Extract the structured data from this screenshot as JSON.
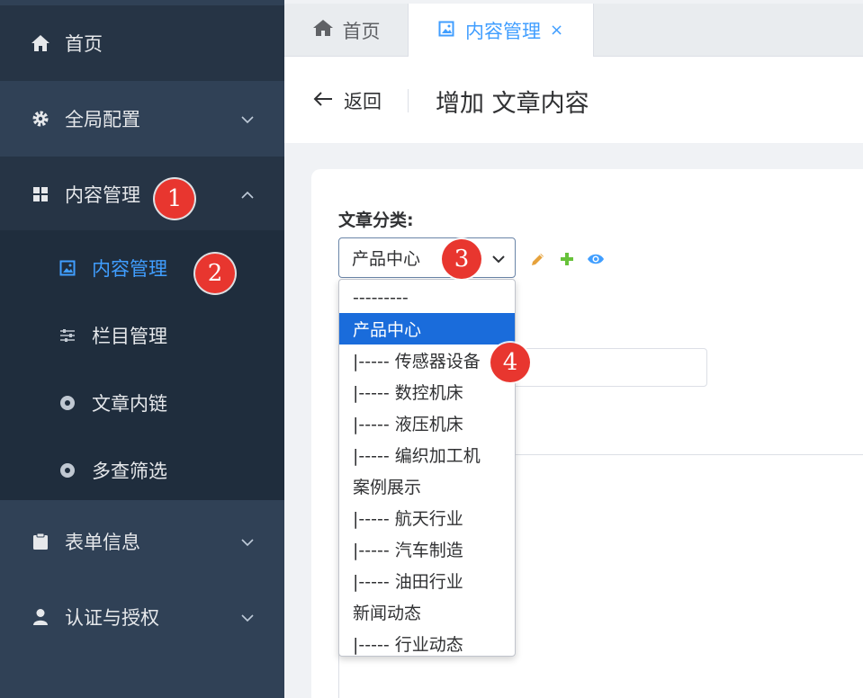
{
  "sidebar": {
    "items": [
      {
        "label": "首页",
        "icon": "home-icon"
      },
      {
        "label": "全局配置",
        "icon": "gear-icon"
      },
      {
        "label": "内容管理",
        "icon": "grid-icon"
      },
      {
        "label": "表单信息",
        "icon": "clipboard-icon"
      },
      {
        "label": "认证与授权",
        "icon": "user-icon"
      }
    ],
    "subitems": [
      {
        "label": "内容管理",
        "icon": "image-icon"
      },
      {
        "label": "栏目管理",
        "icon": "sliders-icon"
      },
      {
        "label": "文章内链",
        "icon": "circle-dot-icon"
      },
      {
        "label": "多查筛选",
        "icon": "circle-dot-icon"
      }
    ]
  },
  "tabs": [
    {
      "label": "首页",
      "icon": "home-icon"
    },
    {
      "label": "内容管理",
      "icon": "image-icon",
      "closable": true,
      "close_glyph": "×"
    }
  ],
  "header": {
    "back_label": "返回",
    "title": "增加 文章内容"
  },
  "form": {
    "category_label": "文章分类:",
    "category_value": "产品中心"
  },
  "dropdown": {
    "options": [
      "---------",
      "产品中心",
      "|----- 传感器设备",
      "|----- 数控机床",
      "|----- 液压机床",
      "|----- 编织加工机",
      "案例展示",
      "|----- 航天行业",
      "|----- 汽车制造",
      "|----- 油田行业",
      "新闻动态",
      "|----- 行业动态"
    ],
    "selected_index": 1
  },
  "annotations": [
    "1",
    "2",
    "3",
    "4"
  ],
  "colors": {
    "sidebar_bg": "#304156",
    "sidebar_active_bg": "#263445",
    "submenu_bg": "#1f2d3d",
    "accent": "#409eff",
    "selected_option": "#1a6cdb",
    "badge": "#e8362f",
    "pencil": "#e6a23c",
    "plus": "#67c23a",
    "eye": "#409eff"
  }
}
